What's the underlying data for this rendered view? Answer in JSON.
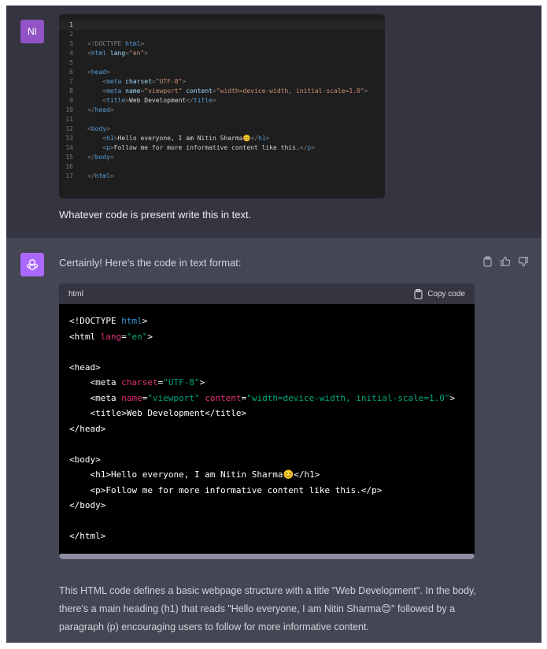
{
  "user": {
    "avatar_initials": "NI",
    "message": "Whatever code is present write this in text.",
    "editor_lines": [
      {
        "n": "1",
        "parts": []
      },
      {
        "n": "2",
        "parts": []
      },
      {
        "n": "3",
        "parts": [
          [
            "pu",
            "<!DOCTYPE "
          ],
          [
            "tg",
            "html"
          ],
          [
            "pu",
            ">"
          ]
        ]
      },
      {
        "n": "4",
        "parts": [
          [
            "pu",
            "<"
          ],
          [
            "tg",
            "html"
          ],
          [
            "at",
            " lang"
          ],
          [
            "pu",
            "="
          ],
          [
            "st",
            "\"en\""
          ],
          [
            "pu",
            ">"
          ]
        ]
      },
      {
        "n": "5",
        "parts": []
      },
      {
        "n": "6",
        "parts": [
          [
            "pu",
            "<"
          ],
          [
            "tg",
            "head"
          ],
          [
            "pu",
            ">"
          ]
        ]
      },
      {
        "n": "7",
        "parts": [
          [
            "pu",
            "    <"
          ],
          [
            "tg",
            "meta"
          ],
          [
            "at",
            " charset"
          ],
          [
            "pu",
            "="
          ],
          [
            "st",
            "\"UTF-8\""
          ],
          [
            "pu",
            ">"
          ]
        ]
      },
      {
        "n": "8",
        "parts": [
          [
            "pu",
            "    <"
          ],
          [
            "tg",
            "meta"
          ],
          [
            "at",
            " name"
          ],
          [
            "pu",
            "="
          ],
          [
            "st",
            "\"viewport\""
          ],
          [
            "at",
            " content"
          ],
          [
            "pu",
            "="
          ],
          [
            "st",
            "\"width=device-width, initial-scale=1.0\""
          ],
          [
            "pu",
            ">"
          ]
        ]
      },
      {
        "n": "9",
        "parts": [
          [
            "pu",
            "    <"
          ],
          [
            "tg",
            "title"
          ],
          [
            "pu",
            ">"
          ],
          [
            "tx",
            "Web Development"
          ],
          [
            "pu",
            "</"
          ],
          [
            "tg",
            "title"
          ],
          [
            "pu",
            ">"
          ]
        ]
      },
      {
        "n": "10",
        "parts": [
          [
            "pu",
            "</"
          ],
          [
            "tg",
            "head"
          ],
          [
            "pu",
            ">"
          ]
        ]
      },
      {
        "n": "11",
        "parts": []
      },
      {
        "n": "12",
        "parts": [
          [
            "pu",
            "<"
          ],
          [
            "tg",
            "body"
          ],
          [
            "pu",
            ">"
          ]
        ]
      },
      {
        "n": "13",
        "parts": [
          [
            "pu",
            "    <"
          ],
          [
            "tg",
            "h1"
          ],
          [
            "pu",
            ">"
          ],
          [
            "tx",
            "Hello everyone, I am Nitin Sharma😊"
          ],
          [
            "pu",
            "</"
          ],
          [
            "tg",
            "h1"
          ],
          [
            "pu",
            ">"
          ]
        ]
      },
      {
        "n": "14",
        "parts": [
          [
            "pu",
            "    <"
          ],
          [
            "tg",
            "p"
          ],
          [
            "pu",
            ">"
          ],
          [
            "tx",
            "Follow me for more informative content like this."
          ],
          [
            "pu",
            "</"
          ],
          [
            "tg",
            "p"
          ],
          [
            "pu",
            ">"
          ]
        ]
      },
      {
        "n": "15",
        "parts": [
          [
            "pu",
            "</"
          ],
          [
            "tg",
            "body"
          ],
          [
            "pu",
            ">"
          ]
        ]
      },
      {
        "n": "16",
        "parts": []
      },
      {
        "n": "17",
        "parts": [
          [
            "pu",
            "</"
          ],
          [
            "tg",
            "html"
          ],
          [
            "pu",
            ">"
          ]
        ]
      }
    ]
  },
  "assistant": {
    "intro": "Certainly! Here's the code in text format:",
    "code_lang": "html",
    "copy_label": "Copy code",
    "code_lines": [
      [
        [
          "tg",
          "<!DOCTYPE "
        ],
        [
          "kw",
          "html"
        ],
        [
          "tg",
          ">"
        ]
      ],
      [
        [
          "tg",
          "<html "
        ],
        [
          "at",
          "lang"
        ],
        [
          "tg",
          "="
        ],
        [
          "st",
          "\"en\""
        ],
        [
          "tg",
          ">"
        ]
      ],
      [],
      [
        [
          "tg",
          "<head>"
        ]
      ],
      [
        [
          "tg",
          "    <meta "
        ],
        [
          "at",
          "charset"
        ],
        [
          "tg",
          "="
        ],
        [
          "st",
          "\"UTF-8\""
        ],
        [
          "tg",
          ">"
        ]
      ],
      [
        [
          "tg",
          "    <meta "
        ],
        [
          "at",
          "name"
        ],
        [
          "tg",
          "="
        ],
        [
          "st",
          "\"viewport\""
        ],
        [
          "tg",
          " "
        ],
        [
          "at",
          "content"
        ],
        [
          "tg",
          "="
        ],
        [
          "st",
          "\"width=device-width, initial-scale=1.0\""
        ],
        [
          "tg",
          ">"
        ]
      ],
      [
        [
          "tg",
          "    <title>Web Development</title>"
        ]
      ],
      [
        [
          "tg",
          "</head>"
        ]
      ],
      [],
      [
        [
          "tg",
          "<body>"
        ]
      ],
      [
        [
          "tg",
          "    <h1>Hello everyone, I am Nitin Sharma😊</h1>"
        ]
      ],
      [
        [
          "tg",
          "    <p>Follow me for more informative content like this.</p>"
        ]
      ],
      [
        [
          "tg",
          "</body>"
        ]
      ],
      [],
      [
        [
          "tg",
          "</html>"
        ]
      ]
    ],
    "description": "This HTML code defines a basic webpage structure with a title \"Web Development\". In the body, there's a main heading (h1) that reads \"Hello everyone, I am Nitin Sharma😊\" followed by a paragraph (p) encouraging users to follow for more informative content.",
    "action_icons": [
      "clipboard-icon",
      "thumbs-up-icon",
      "thumbs-down-icon"
    ]
  },
  "colors": {
    "user_bg": "#343541",
    "assistant_bg": "#444654",
    "user_avatar": "#9254c5",
    "bot_avatar": "#ab68ff",
    "code_bg": "#000000"
  }
}
